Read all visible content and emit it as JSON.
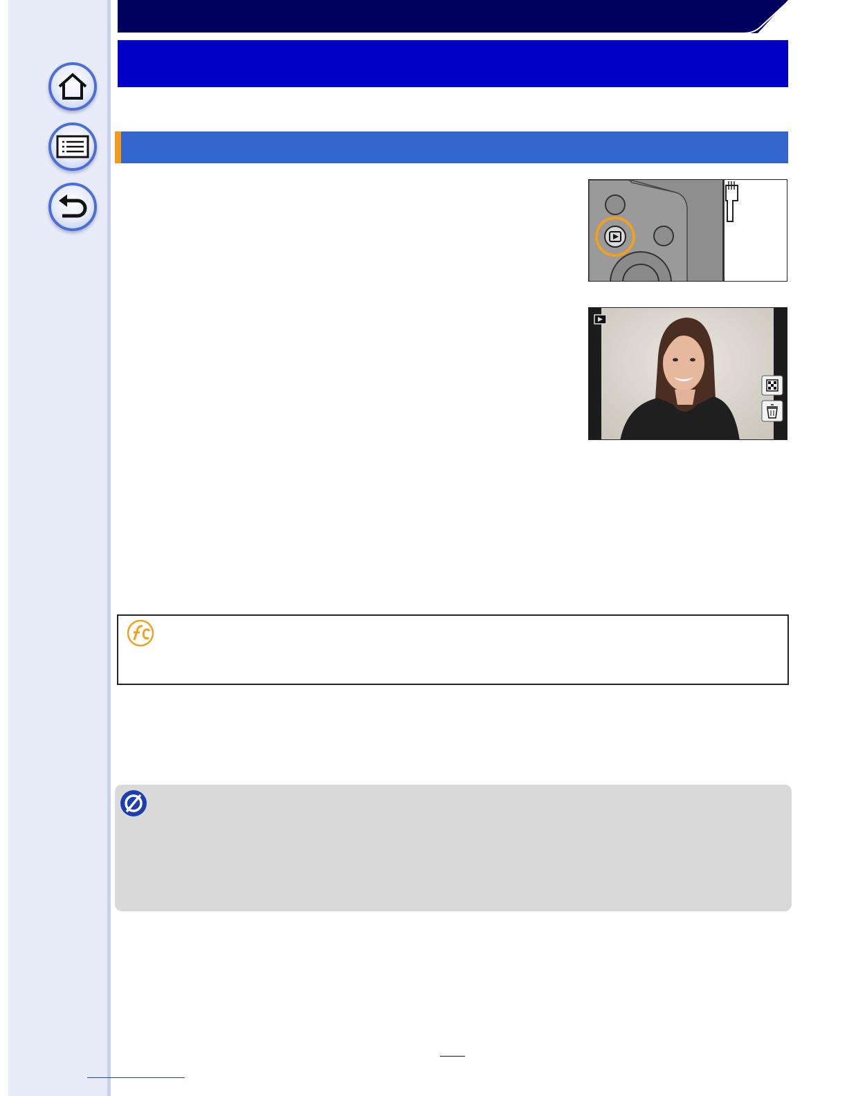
{
  "sidebar": {
    "buttons": [
      {
        "name": "home",
        "icon": "home-icon"
      },
      {
        "name": "contents",
        "icon": "list-icon"
      },
      {
        "name": "back",
        "icon": "return-arrow-icon"
      }
    ]
  },
  "header": {
    "title": "",
    "chapter": "",
    "band_color": "#0000c6",
    "top_color": "#00005e"
  },
  "section": {
    "title": "",
    "color": "#3366cc",
    "accent_color": "#f39a1a"
  },
  "illustrations": {
    "camera_button": {
      "icon": "playback-button-icon",
      "highlight_color": "#f0a020"
    },
    "playback_screen": {
      "mode_icon": "playback-mode-icon",
      "side_icons": [
        "thumbnail-grid-icon",
        "trash-icon"
      ]
    }
  },
  "tip": {
    "icon": "wrench-c-icon",
    "icon_color": "#f0a020",
    "text": ""
  },
  "note": {
    "icon": "not-available-icon",
    "icon_color": "#1b3fb0",
    "text": ""
  },
  "footer": {
    "page_number": ""
  }
}
